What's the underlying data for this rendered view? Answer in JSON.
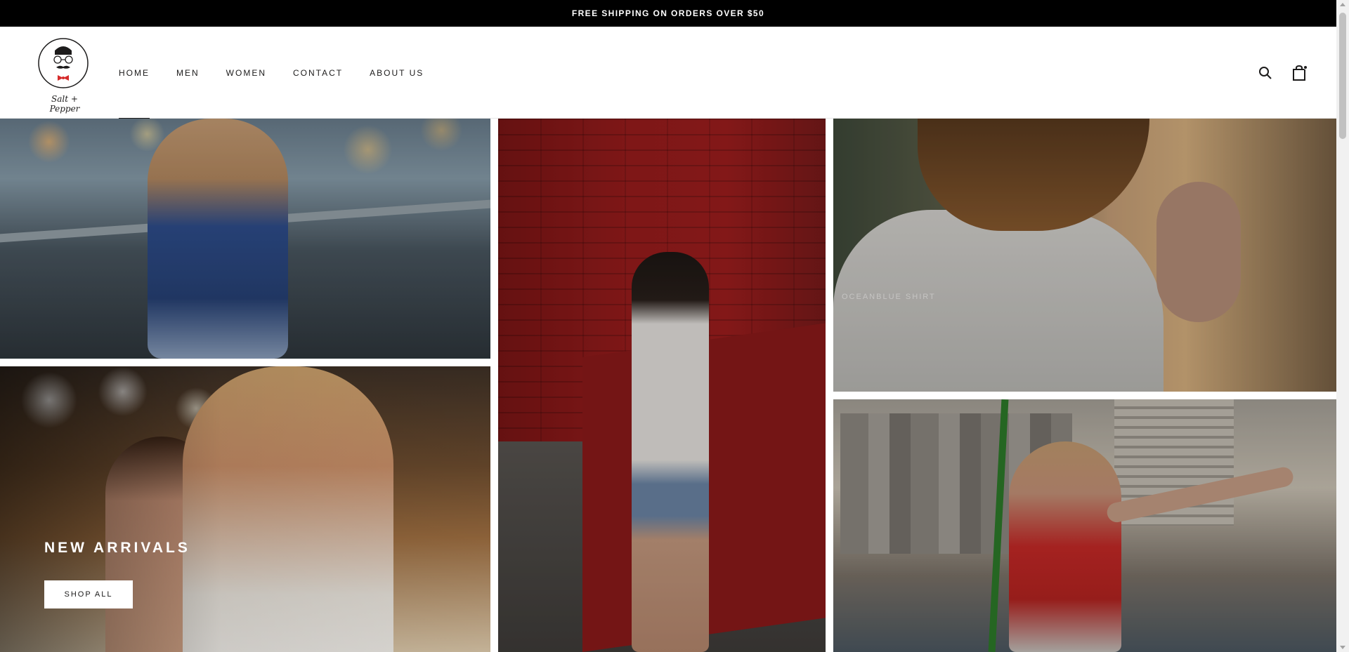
{
  "announcement": {
    "text": "FREE SHIPPING ON ORDERS OVER $50"
  },
  "brand": {
    "logo_text": "Salt + Pepper",
    "accent": "#d62b2b"
  },
  "nav": {
    "items": [
      {
        "label": "HOME",
        "active": true
      },
      {
        "label": "MEN",
        "active": false
      },
      {
        "label": "WOMEN",
        "active": false
      },
      {
        "label": "CONTACT",
        "active": false
      },
      {
        "label": "ABOUT US",
        "active": false
      }
    ]
  },
  "header_icons": {
    "search": "search-icon",
    "cart": "shopping-bag-icon"
  },
  "collage": {
    "faded_label": "OCEANBLUE SHIRT"
  },
  "hero": {
    "title": "NEW ARRIVALS",
    "button_label": "SHOP ALL"
  },
  "colors": {
    "announcement_bg": "#000000",
    "text": "#1c1b1b",
    "button_bg": "#ffffff"
  }
}
